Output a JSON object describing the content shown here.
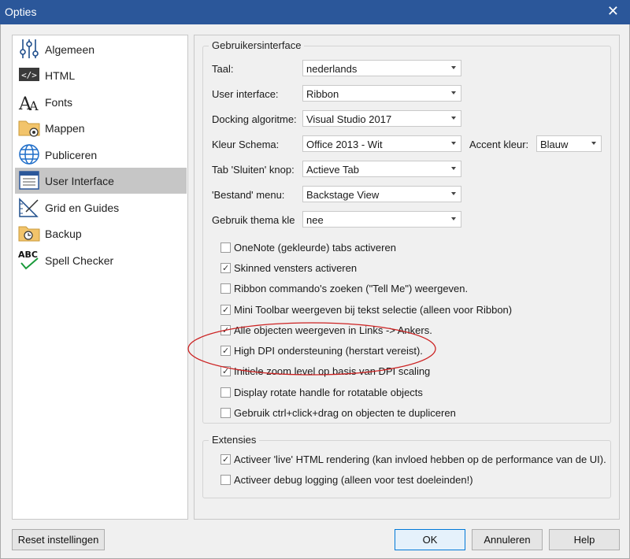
{
  "window": {
    "title": "Opties"
  },
  "sidebar": {
    "items": [
      {
        "label": "Algemeen",
        "icon": "sliders-icon"
      },
      {
        "label": "HTML",
        "icon": "html-tag-icon"
      },
      {
        "label": "Fonts",
        "icon": "font-icon"
      },
      {
        "label": "Mappen",
        "icon": "folder-gear-icon"
      },
      {
        "label": "Publiceren",
        "icon": "globe-icon"
      },
      {
        "label": "User Interface",
        "icon": "window-icon",
        "selected": true
      },
      {
        "label": "Grid en Guides",
        "icon": "grid-ruler-icon"
      },
      {
        "label": "Backup",
        "icon": "backup-folder-icon"
      },
      {
        "label": "Spell Checker",
        "icon": "abc-check-icon"
      }
    ]
  },
  "ui_group": {
    "legend": "Gebruikersinterface",
    "fields": {
      "taal": {
        "label": "Taal:",
        "value": "nederlands"
      },
      "user_interface": {
        "label": "User interface:",
        "value": "Ribbon"
      },
      "docking": {
        "label": "Docking algoritme:",
        "value": "Visual Studio 2017"
      },
      "kleur_schema": {
        "label": "Kleur Schema:",
        "value": "Office 2013 - Wit"
      },
      "accent_kleur": {
        "label": "Accent kleur:",
        "value": "Blauw"
      },
      "tab_sluiten": {
        "label": "Tab 'Sluiten' knop:",
        "value": "Actieve Tab"
      },
      "bestand_menu": {
        "label": "'Bestand' menu:",
        "value": "Backstage View"
      },
      "thema_kleur": {
        "label": "Gebruik thema kle",
        "value": "nee"
      }
    },
    "checkboxes": [
      {
        "label": "OneNote (gekleurde) tabs activeren",
        "checked": false
      },
      {
        "label": "Skinned vensters activeren",
        "checked": true
      },
      {
        "label": "Ribbon commando's zoeken (\"Tell Me\") weergeven.",
        "checked": false
      },
      {
        "label": "Mini Toolbar weergeven bij tekst selectie (alleen voor Ribbon)",
        "checked": true
      },
      {
        "label": "Alle objecten weergeven in Links -> Ankers.",
        "checked": true
      },
      {
        "label": "High DPI ondersteuning (herstart vereist).",
        "checked": true
      },
      {
        "label": "Initiele zoom level op basis van DPI scaling",
        "checked": true
      },
      {
        "label": "Display rotate handle for rotatable objects",
        "checked": false
      },
      {
        "label": "Gebruik ctrl+click+drag on objecten te dupliceren",
        "checked": false
      }
    ]
  },
  "ext_group": {
    "legend": "Extensies",
    "checkboxes": [
      {
        "label": "Activeer 'live' HTML rendering (kan invloed hebben op de performance van de UI).",
        "checked": true
      },
      {
        "label": "Activeer debug logging (alleen voor test doeleinden!)",
        "checked": false
      }
    ]
  },
  "buttons": {
    "reset": "Reset instellingen",
    "ok": "OK",
    "cancel": "Annuleren",
    "help": "Help"
  },
  "check_glyph": "✓",
  "close_glyph": "✕",
  "colors": {
    "titlebar": "#2b579a",
    "selection": "#c6c6c6",
    "annotation": "#cc2222"
  }
}
